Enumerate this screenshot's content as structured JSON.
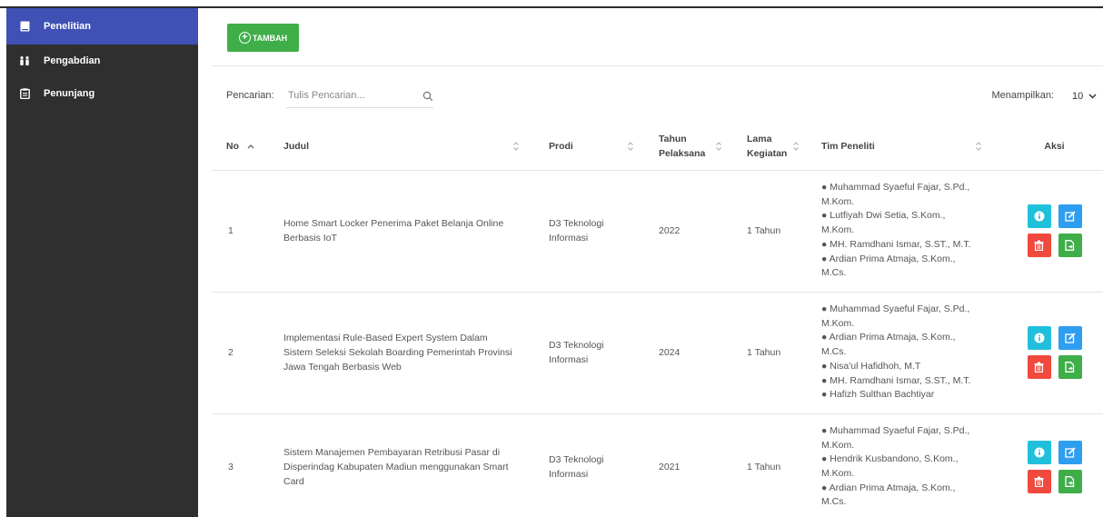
{
  "sidebar": {
    "items": [
      {
        "label": "Penelitian",
        "icon": "book-icon",
        "active": true
      },
      {
        "label": "Pengabdian",
        "icon": "people-icon",
        "active": false
      },
      {
        "label": "Penunjang",
        "icon": "clipboard-icon",
        "active": false
      }
    ]
  },
  "toolbar": {
    "add_label": "TAMBAH"
  },
  "search": {
    "label": "Pencarian:",
    "placeholder": "Tulis Pencarian..."
  },
  "page_size": {
    "label": "Menampilkan:",
    "value": "10"
  },
  "table": {
    "headers": {
      "no": "No",
      "judul": "Judul",
      "prodi": "Prodi",
      "tahun_1": "Tahun",
      "tahun_2": "Pelaksana",
      "lama_1": "Lama",
      "lama_2": "Kegiatan",
      "tim": "Tim Peneliti",
      "aksi": "Aksi"
    },
    "rows": [
      {
        "no": "1",
        "judul": "Home Smart Locker Penerima Paket Belanja Online Berbasis IoT",
        "prodi": "D3 Teknologi Informasi",
        "tahun": "2022",
        "lama": "1 Tahun",
        "tim": [
          "● Muhammad Syaeful Fajar, S.Pd., M.Kom.",
          "● Lutfiyah Dwi Setia, S.Kom., M.Kom.",
          "● MH. Ramdhani Ismar, S.ST., M.T.",
          "● Ardian Prima Atmaja, S.Kom., M.Cs."
        ]
      },
      {
        "no": "2",
        "judul": "Implementasi Rule-Based Expert System Dalam Sistem Seleksi Sekolah Boarding Pemerintah Provinsi Jawa Tengah Berbasis Web",
        "prodi": "D3 Teknologi Informasi",
        "tahun": "2024",
        "lama": "1 Tahun",
        "tim": [
          "● Muhammad Syaeful Fajar, S.Pd., M.Kom.",
          "● Ardian Prima Atmaja, S.Kom., M.Cs.",
          "● Nisa'ul Hafidhoh, M.T",
          "● MH. Ramdhani Ismar, S.ST., M.T.",
          "● Hafizh Sulthan Bachtiyar"
        ]
      },
      {
        "no": "3",
        "judul": "Sistem Manajemen Pembayaran Retribusi Pasar di Disperindag Kabupaten Madiun menggunakan Smart Card",
        "prodi": "D3 Teknologi Informasi",
        "tahun": "2021",
        "lama": "1 Tahun",
        "tim": [
          "● Muhammad Syaeful Fajar, S.Pd., M.Kom.",
          "● Hendrik Kusbandono, S.Kom., M.Kom.",
          "● Ardian Prima Atmaja, S.Kom., M.Cs."
        ]
      }
    ]
  },
  "colors": {
    "sidebar_bg": "#2f2f2f",
    "sidebar_active": "#3f51b5",
    "add_button": "#3fae49",
    "info": "#20c0dd",
    "edit": "#2d9ef0",
    "delete": "#f0493e",
    "export": "#3fae49"
  }
}
